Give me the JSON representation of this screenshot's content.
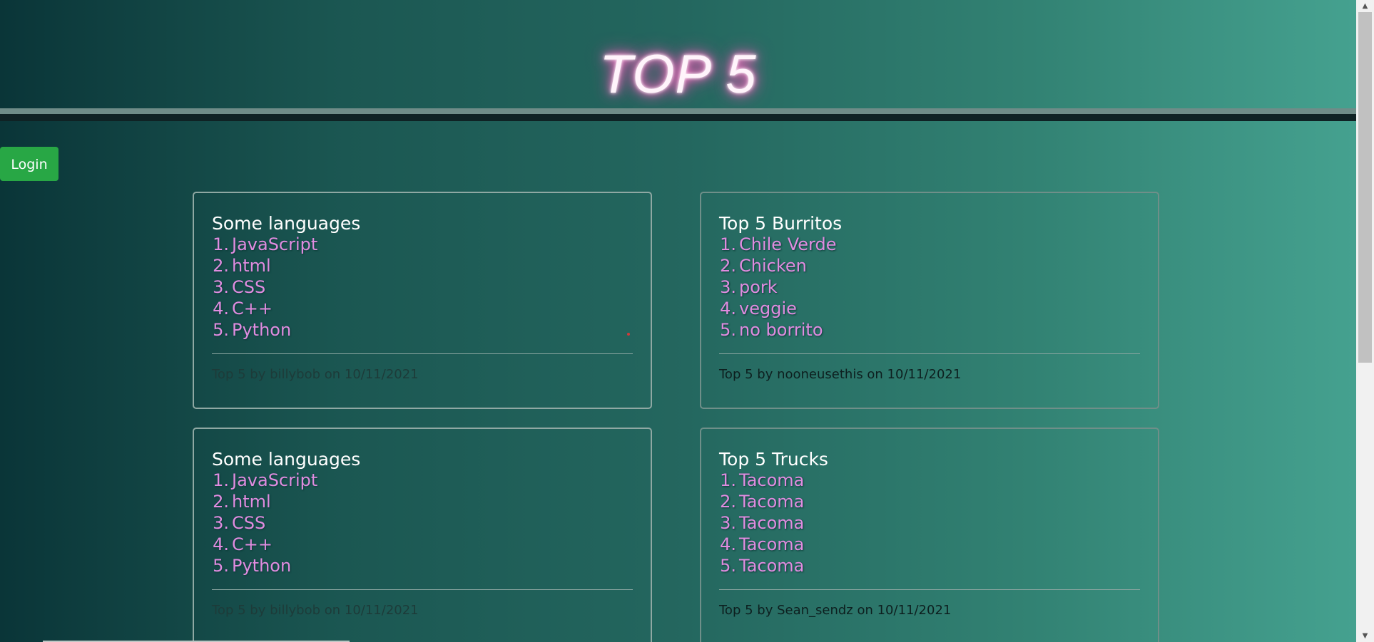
{
  "header": {
    "title": "TOP 5"
  },
  "auth": {
    "login_label": "Login"
  },
  "colors": {
    "list_item": "#e08ce0",
    "login_button": "#28a745",
    "title_glow": "#ff5fc0"
  },
  "cards": [
    {
      "title": "Some languages",
      "items": [
        {
          "num": "1.",
          "text": "JavaScript"
        },
        {
          "num": "2.",
          "text": "html"
        },
        {
          "num": "3.",
          "text": "CSS"
        },
        {
          "num": "4.",
          "text": "C++"
        },
        {
          "num": "5.",
          "text": "Python"
        }
      ],
      "footer": "Top 5 by billybob on 10/11/2021"
    },
    {
      "title": "Top 5 Burritos",
      "items": [
        {
          "num": "1.",
          "text": "Chile Verde"
        },
        {
          "num": "2.",
          "text": "Chicken"
        },
        {
          "num": "3.",
          "text": "pork"
        },
        {
          "num": "4.",
          "text": "veggie"
        },
        {
          "num": "5.",
          "text": "no borrito"
        }
      ],
      "footer": "Top 5 by nooneusethis on 10/11/2021"
    },
    {
      "title": "Some languages",
      "items": [
        {
          "num": "1.",
          "text": "JavaScript"
        },
        {
          "num": "2.",
          "text": "html"
        },
        {
          "num": "3.",
          "text": "CSS"
        },
        {
          "num": "4.",
          "text": "C++"
        },
        {
          "num": "5.",
          "text": "Python"
        }
      ],
      "footer": "Top 5 by billybob on 10/11/2021"
    },
    {
      "title": "Top 5 Trucks",
      "items": [
        {
          "num": "1.",
          "text": "Tacoma"
        },
        {
          "num": "2.",
          "text": "Tacoma"
        },
        {
          "num": "3.",
          "text": "Tacoma"
        },
        {
          "num": "4.",
          "text": "Tacoma"
        },
        {
          "num": "5.",
          "text": "Tacoma"
        }
      ],
      "footer": "Top 5 by Sean_sendz on 10/11/2021"
    }
  ],
  "scrollbar": {
    "up_icon": "chevron-up-icon",
    "down_icon": "chevron-down-icon"
  }
}
